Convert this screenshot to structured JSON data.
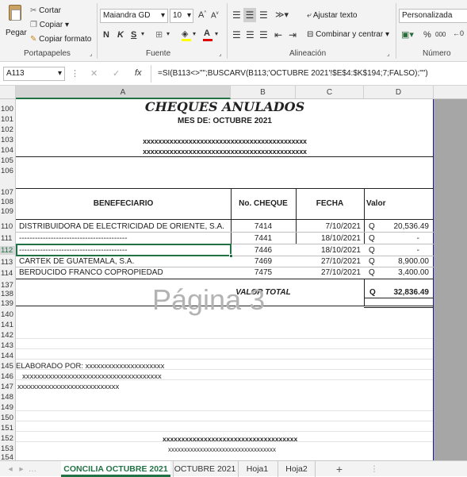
{
  "ribbon": {
    "clipboard": {
      "label": "Portapapeles",
      "paste": "Pegar",
      "cut": "Cortar",
      "copy": "Copiar",
      "format_painter": "Copiar formato"
    },
    "font": {
      "label": "Fuente",
      "font_name": "Maiandra GD",
      "font_size": "10",
      "bold": "N",
      "italic": "K",
      "underline": "S",
      "grow": "A",
      "shrink": "A",
      "font_color": "A"
    },
    "alignment": {
      "label": "Alineación",
      "wrap_text": "Ajustar texto",
      "merge_center": "Combinar y centrar"
    },
    "number": {
      "label": "Número",
      "format": "Personalizada",
      "percent": "%",
      "thousands": "000"
    }
  },
  "formula_bar": {
    "name_box": "A113",
    "fx": "fx",
    "formula": "=SI(B113<>\"\";BUSCARV(B113;'OCTUBRE 2021'!$E$4:$K$194;7;FALSO);\"\")"
  },
  "columns": [
    "A",
    "B",
    "C",
    "D"
  ],
  "rows": [
    "100",
    "101",
    "102",
    "103",
    "104",
    "105",
    "106",
    "107",
    "108",
    "109",
    "110",
    "111",
    "112",
    "113",
    "114",
    "137",
    "138",
    "139",
    "140",
    "141",
    "142",
    "143",
    "144",
    "145",
    "146",
    "147",
    "148",
    "149",
    "150",
    "151",
    "152",
    "153",
    "154"
  ],
  "report": {
    "title": "CHEQUES ANULADOS",
    "subtitle": "MES DE: OCTUBRE 2021",
    "masked_line_1": "xxxxxxxxxxxxxxxxxxxxxxxxxxxxxxxxxxxxxxxxxxx",
    "masked_line_2": "xxxxxxxxxxxxxxxxxxxxxxxxxxxxxxxxxxxxxxxxxxx",
    "headers": {
      "beneficiary": "BENEFECIARIO",
      "cheque_no": "No. CHEQUE",
      "date": "FECHA",
      "value": "Valor"
    },
    "entries": [
      {
        "beneficiary": "DISTRIBUIDORA DE ELECTRICIDAD DE ORIENTE, S.A.",
        "cheque": "7414",
        "date": "7/10/2021",
        "cur": "Q",
        "amount": "20,536.49"
      },
      {
        "beneficiary": "-----------------------------------------",
        "cheque": "7441",
        "date": "18/10/2021",
        "cur": "Q",
        "amount": "-"
      },
      {
        "beneficiary": "-----------------------------------------",
        "cheque": "7446",
        "date": "18/10/2021",
        "cur": "Q",
        "amount": "-"
      },
      {
        "beneficiary": "CARTEK DE GUATEMALA, S.A.",
        "cheque": "7469",
        "date": "27/10/2021",
        "cur": "Q",
        "amount": "8,900.00"
      },
      {
        "beneficiary": "BERDUCIDO FRANCO COPROPIEDAD",
        "cheque": "7475",
        "date": "27/10/2021",
        "cur": "Q",
        "amount": "3,400.00"
      }
    ],
    "total_label": "VALOR TOTAL",
    "total_cur": "Q",
    "total_amount": "32,836.49",
    "page_watermark": "Página 3",
    "prepared_by": "ELABORADO POR: xxxxxxxxxxxxxxxxxxxxx",
    "masked_line_3": "xxxxxxxxxxxxxxxxxxxxxxxxxxxxxxxxxxxxx",
    "masked_line_4": "xxxxxxxxxxxxxxxxxxxxxxxxxxx",
    "signature_line_1": "xxxxxxxxxxxxxxxxxxxxxxxxxxxxxxxxxxxx",
    "signature_line_2": "xxxxxxxxxxxxxxxxxxxxxxxxxxxxxxxxxx"
  },
  "sheet_tabs": [
    "CONCILIA OCTUBRE 2021",
    "OCTUBRE 2021",
    "Hoja1",
    "Hoja2"
  ],
  "add_sheet": "+",
  "colors": {
    "accent_green": "#217346",
    "grid": "#d9d9d9",
    "print_border": "#1a1aa0",
    "grey_area": "#a6a6a6"
  }
}
